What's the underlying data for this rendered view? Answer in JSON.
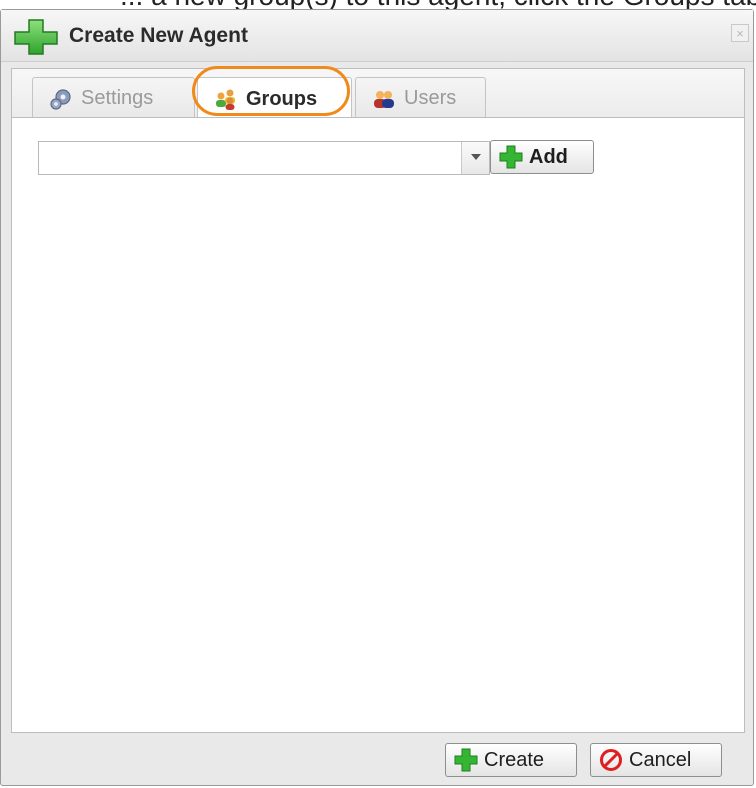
{
  "caption_fragment": "... a new group(s) to this agent, click the Groups tab...",
  "dialog": {
    "title": "Create New Agent",
    "close_label": "×"
  },
  "tabs": [
    {
      "label": "Settings",
      "icon": "gear-icon",
      "active": false
    },
    {
      "label": "Groups",
      "icon": "groups-icon",
      "active": true
    },
    {
      "label": "Users",
      "icon": "users-icon",
      "active": false
    }
  ],
  "groups_panel": {
    "select_value": "",
    "add_label": "Add"
  },
  "footer": {
    "create_label": "Create",
    "cancel_label": "Cancel"
  },
  "colors": {
    "highlight": "#f08a1c",
    "add_green": "#35b534",
    "cancel_red": "#e02020"
  }
}
